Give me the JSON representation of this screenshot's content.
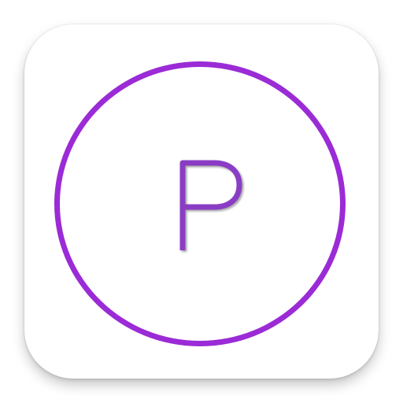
{
  "icon": {
    "letter": "P",
    "ring_color": "#9b2bd6",
    "letter_color": "#8a3cc4",
    "background_color": "#ffffff"
  }
}
